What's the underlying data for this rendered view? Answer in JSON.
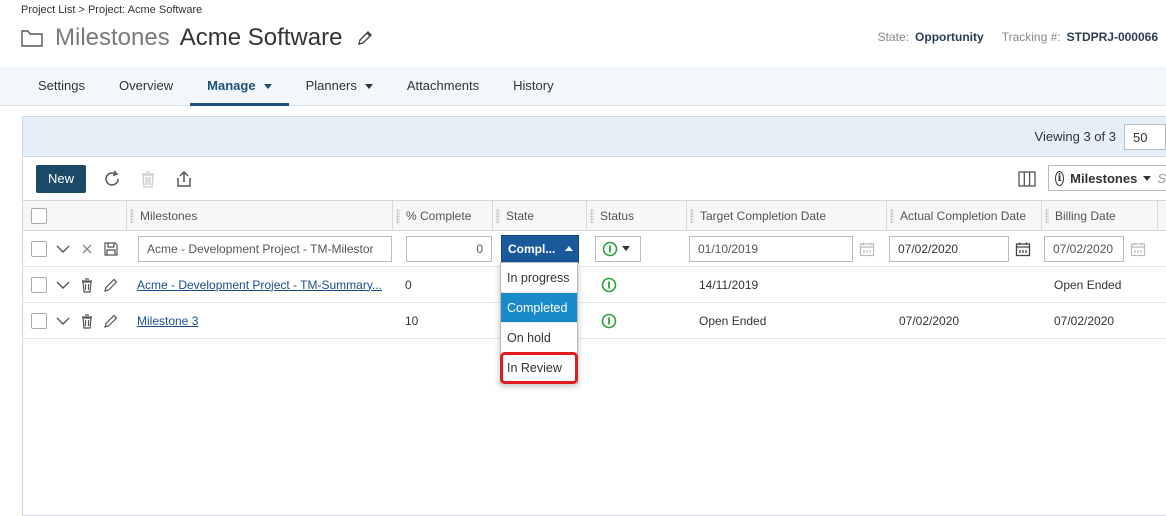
{
  "breadcrumb": "Project List > Project: Acme Software",
  "page_title": "Milestones",
  "project_name": "Acme Software",
  "meta": {
    "state_label": "State:",
    "state_value": "Opportunity",
    "tracking_label": "Tracking #:",
    "tracking_value": "STDPRJ-000066"
  },
  "tabs": [
    {
      "label": "Settings"
    },
    {
      "label": "Overview"
    },
    {
      "label": "Manage"
    },
    {
      "label": "Planners"
    },
    {
      "label": "Attachments"
    },
    {
      "label": "History"
    }
  ],
  "pager": {
    "viewing_prefix": "Viewing",
    "viewing_count": "3",
    "viewing_of": "of",
    "viewing_total": "3",
    "page_size": "50"
  },
  "toolbar": {
    "new_label": "New",
    "view_label": "Milestones",
    "view_hint": "S"
  },
  "columns": [
    "Milestones",
    "% Complete",
    "State",
    "Status",
    "Target Completion Date",
    "Actual Completion Date",
    "Billing Date"
  ],
  "edit_row": {
    "milestone_value": "Acme - Development Project - TM-Milestor",
    "pct_value": "0",
    "state_value": "Compl...",
    "target_date": "01/10/2019",
    "actual_date": "07/02/2020",
    "billing_date": "07/02/2020"
  },
  "rows": [
    {
      "milestone": "Acme - Development Project - TM-Summary...",
      "pct": "0",
      "target": "14/11/2019",
      "actual": "",
      "billing": "Open Ended"
    },
    {
      "milestone": "Milestone 3",
      "pct": "10",
      "target": "Open Ended",
      "actual": "07/02/2020",
      "billing": "07/02/2020"
    }
  ],
  "state_options": [
    "In progress",
    "Completed",
    "On hold",
    "In Review"
  ],
  "colors": {
    "accent": "#1f4f7a",
    "new_button": "#1c4a66",
    "selected_option": "#1a8bc9",
    "highlight": "#e01b1b",
    "status_green": "#2aa03a"
  }
}
